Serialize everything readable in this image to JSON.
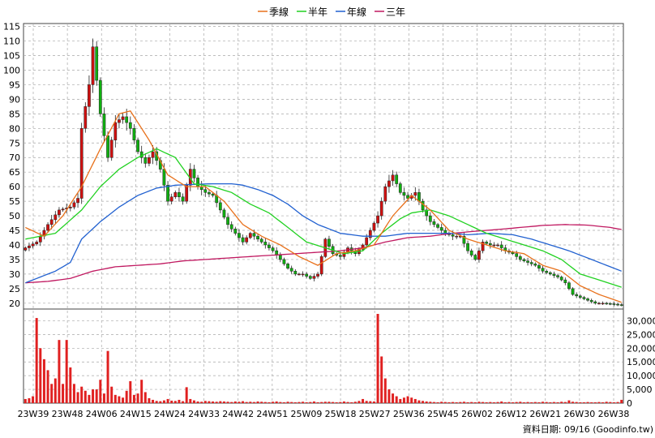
{
  "chart_data": {
    "type": "candlestick",
    "legend": [
      {
        "name": "季線",
        "color": "#e8701a"
      },
      {
        "name": "半年",
        "color": "#21d121"
      },
      {
        "name": "年線",
        "color": "#2060d0"
      },
      {
        "name": "三年",
        "color": "#c01860"
      }
    ],
    "price_axis": {
      "min": 18,
      "max": 116,
      "ticks": [
        20,
        25,
        30,
        35,
        40,
        45,
        50,
        55,
        60,
        65,
        70,
        75,
        80,
        85,
        90,
        95,
        100,
        105,
        110,
        115
      ],
      "side": "left"
    },
    "volume_axis": {
      "min": 0,
      "max": 32500,
      "ticks": [
        0,
        5000,
        10000,
        15000,
        20000,
        25000,
        30000
      ],
      "tick_labels": [
        "0",
        "5,000",
        "10,000",
        "15,000",
        "20,000",
        "25,000",
        "30,000"
      ],
      "side": "right"
    },
    "x_tick_labels": [
      "23W39",
      "23W48",
      "24W06",
      "24W15",
      "24W24",
      "24W33",
      "24W42",
      "24W51",
      "25W09",
      "25W18",
      "25W27",
      "25W36",
      "25W45",
      "26W02",
      "26W12",
      "26W21",
      "26W30",
      "26W38"
    ],
    "grid": true,
    "footer": "資料日期: 09/16  (Goodinfo.tw)",
    "price_close_anchors": [
      [
        0,
        39
      ],
      [
        3,
        41
      ],
      [
        6,
        47
      ],
      [
        9,
        52
      ],
      [
        12,
        53
      ],
      [
        14,
        56
      ],
      [
        15,
        80
      ],
      [
        17,
        95
      ],
      [
        18,
        108
      ],
      [
        20,
        85
      ],
      [
        22,
        70
      ],
      [
        24,
        82
      ],
      [
        26,
        84
      ],
      [
        28,
        80
      ],
      [
        30,
        72
      ],
      [
        32,
        68
      ],
      [
        34,
        72
      ],
      [
        36,
        66
      ],
      [
        38,
        55
      ],
      [
        40,
        58
      ],
      [
        42,
        55
      ],
      [
        44,
        66
      ],
      [
        46,
        60
      ],
      [
        48,
        58
      ],
      [
        50,
        57
      ],
      [
        52,
        52
      ],
      [
        54,
        47
      ],
      [
        56,
        44
      ],
      [
        58,
        41
      ],
      [
        60,
        44
      ],
      [
        62,
        42
      ],
      [
        64,
        40
      ],
      [
        66,
        38
      ],
      [
        68,
        35
      ],
      [
        70,
        32
      ],
      [
        72,
        30
      ],
      [
        74,
        30
      ],
      [
        76,
        28.5
      ],
      [
        78,
        30
      ],
      [
        80,
        42
      ],
      [
        82,
        37
      ],
      [
        84,
        36
      ],
      [
        86,
        39
      ],
      [
        88,
        37
      ],
      [
        90,
        40
      ],
      [
        92,
        45
      ],
      [
        94,
        50
      ],
      [
        96,
        60
      ],
      [
        98,
        64
      ],
      [
        100,
        58
      ],
      [
        102,
        56
      ],
      [
        104,
        58
      ],
      [
        106,
        52
      ],
      [
        108,
        48
      ],
      [
        110,
        46
      ],
      [
        112,
        44
      ],
      [
        114,
        43
      ],
      [
        116,
        43
      ],
      [
        118,
        38
      ],
      [
        120,
        35
      ],
      [
        122,
        41
      ],
      [
        124,
        40
      ],
      [
        126,
        40
      ],
      [
        128,
        38
      ],
      [
        130,
        37
      ],
      [
        132,
        35
      ],
      [
        134,
        34
      ],
      [
        136,
        33
      ],
      [
        138,
        31
      ],
      [
        140,
        30
      ],
      [
        142,
        29
      ],
      [
        144,
        27
      ],
      [
        146,
        23
      ],
      [
        148,
        22
      ],
      [
        150,
        21
      ],
      [
        152,
        20
      ],
      [
        154,
        20
      ],
      [
        156,
        19.8
      ],
      [
        158,
        19.5
      ],
      [
        159,
        19.4
      ]
    ],
    "ma_quarter": [
      [
        0,
        46
      ],
      [
        5,
        43
      ],
      [
        10,
        50
      ],
      [
        15,
        60
      ],
      [
        20,
        73
      ],
      [
        25,
        85
      ],
      [
        28,
        86
      ],
      [
        33,
        76
      ],
      [
        38,
        64
      ],
      [
        43,
        60
      ],
      [
        48,
        60
      ],
      [
        53,
        55
      ],
      [
        58,
        47
      ],
      [
        63,
        43
      ],
      [
        68,
        40
      ],
      [
        73,
        36
      ],
      [
        78,
        33
      ],
      [
        83,
        37
      ],
      [
        88,
        38
      ],
      [
        93,
        40
      ],
      [
        98,
        50
      ],
      [
        103,
        57
      ],
      [
        108,
        52
      ],
      [
        113,
        45
      ],
      [
        118,
        42
      ],
      [
        123,
        40
      ],
      [
        128,
        38
      ],
      [
        133,
        37
      ],
      [
        138,
        33
      ],
      [
        143,
        31
      ],
      [
        148,
        26
      ],
      [
        153,
        23
      ],
      [
        159,
        20.3
      ]
    ],
    "ma_half": [
      [
        0,
        42
      ],
      [
        8,
        44
      ],
      [
        15,
        52
      ],
      [
        20,
        60
      ],
      [
        25,
        66
      ],
      [
        30,
        70
      ],
      [
        35,
        73
      ],
      [
        40,
        70
      ],
      [
        45,
        61
      ],
      [
        50,
        60
      ],
      [
        55,
        58
      ],
      [
        60,
        54
      ],
      [
        65,
        51
      ],
      [
        70,
        46
      ],
      [
        75,
        41
      ],
      [
        80,
        39
      ],
      [
        85,
        37
      ],
      [
        90,
        38
      ],
      [
        95,
        44
      ],
      [
        100,
        49
      ],
      [
        103,
        51
      ],
      [
        108,
        52
      ],
      [
        113,
        50
      ],
      [
        118,
        47
      ],
      [
        123,
        44
      ],
      [
        128,
        42
      ],
      [
        133,
        40
      ],
      [
        138,
        38
      ],
      [
        143,
        35
      ],
      [
        148,
        30
      ],
      [
        153,
        28
      ],
      [
        159,
        25.5
      ]
    ],
    "ma_year": [
      [
        0,
        27
      ],
      [
        4,
        29
      ],
      [
        8,
        31
      ],
      [
        12,
        34
      ],
      [
        15,
        42
      ],
      [
        20,
        48
      ],
      [
        25,
        53
      ],
      [
        30,
        57
      ],
      [
        35,
        59.5
      ],
      [
        40,
        60.5
      ],
      [
        45,
        60.8
      ],
      [
        50,
        61
      ],
      [
        55,
        61
      ],
      [
        58,
        60.5
      ],
      [
        62,
        59
      ],
      [
        66,
        57
      ],
      [
        70,
        54
      ],
      [
        74,
        50
      ],
      [
        78,
        47
      ],
      [
        84,
        44
      ],
      [
        90,
        43
      ],
      [
        96,
        43
      ],
      [
        102,
        44
      ],
      [
        108,
        44
      ],
      [
        114,
        44
      ],
      [
        118,
        43.5
      ],
      [
        124,
        44
      ],
      [
        130,
        43.5
      ],
      [
        135,
        42
      ],
      [
        140,
        40
      ],
      [
        145,
        38
      ],
      [
        150,
        35.5
      ],
      [
        155,
        33
      ],
      [
        159,
        31
      ]
    ],
    "ma_3year": [
      [
        0,
        27
      ],
      [
        6,
        27.5
      ],
      [
        12,
        28.5
      ],
      [
        18,
        31
      ],
      [
        24,
        32.5
      ],
      [
        30,
        33
      ],
      [
        36,
        33.5
      ],
      [
        42,
        34.5
      ],
      [
        48,
        35
      ],
      [
        54,
        35.5
      ],
      [
        60,
        36
      ],
      [
        66,
        36.5
      ],
      [
        72,
        37
      ],
      [
        78,
        37.5
      ],
      [
        84,
        38
      ],
      [
        90,
        39
      ],
      [
        96,
        41
      ],
      [
        102,
        42.5
      ],
      [
        108,
        43
      ],
      [
        114,
        44
      ],
      [
        120,
        44.7
      ],
      [
        126,
        45.3
      ],
      [
        132,
        46
      ],
      [
        138,
        46.7
      ],
      [
        144,
        47
      ],
      [
        150,
        46.8
      ],
      [
        156,
        46
      ],
      [
        159,
        45.3
      ]
    ],
    "volume_bars": [
      [
        0,
        1500
      ],
      [
        1,
        1800
      ],
      [
        2,
        2500
      ],
      [
        3,
        31000
      ],
      [
        4,
        20000
      ],
      [
        5,
        16000
      ],
      [
        6,
        12000
      ],
      [
        7,
        7000
      ],
      [
        8,
        9000
      ],
      [
        9,
        23000
      ],
      [
        10,
        7000
      ],
      [
        11,
        23000
      ],
      [
        12,
        13000
      ],
      [
        13,
        7000
      ],
      [
        14,
        4000
      ],
      [
        15,
        6000
      ],
      [
        16,
        4500
      ],
      [
        17,
        3000
      ],
      [
        18,
        5000
      ],
      [
        19,
        5000
      ],
      [
        20,
        8500
      ],
      [
        21,
        3500
      ],
      [
        22,
        19000
      ],
      [
        23,
        6000
      ],
      [
        24,
        3000
      ],
      [
        25,
        2500
      ],
      [
        26,
        2000
      ],
      [
        27,
        4500
      ],
      [
        28,
        8000
      ],
      [
        29,
        3000
      ],
      [
        30,
        3500
      ],
      [
        31,
        8500
      ],
      [
        32,
        4000
      ],
      [
        33,
        1800
      ],
      [
        34,
        1200
      ],
      [
        35,
        800
      ],
      [
        36,
        700
      ],
      [
        37,
        1000
      ],
      [
        38,
        1500
      ],
      [
        39,
        900
      ],
      [
        40,
        800
      ],
      [
        41,
        1200
      ],
      [
        42,
        700
      ],
      [
        43,
        5800
      ],
      [
        44,
        1500
      ],
      [
        45,
        1000
      ],
      [
        46,
        600
      ],
      [
        47,
        500
      ],
      [
        48,
        800
      ],
      [
        49,
        700
      ],
      [
        50,
        600
      ],
      [
        51,
        500
      ],
      [
        52,
        700
      ],
      [
        53,
        600
      ],
      [
        54,
        500
      ],
      [
        55,
        400
      ],
      [
        56,
        600
      ],
      [
        57,
        500
      ],
      [
        58,
        700
      ],
      [
        59,
        400
      ],
      [
        60,
        500
      ],
      [
        61,
        400
      ],
      [
        62,
        600
      ],
      [
        63,
        500
      ],
      [
        64,
        400
      ],
      [
        65,
        300
      ],
      [
        66,
        500
      ],
      [
        67,
        600
      ],
      [
        68,
        400
      ],
      [
        69,
        300
      ],
      [
        70,
        500
      ],
      [
        71,
        400
      ],
      [
        72,
        300
      ],
      [
        73,
        400
      ],
      [
        74,
        500
      ],
      [
        75,
        300
      ],
      [
        76,
        400
      ],
      [
        77,
        600
      ],
      [
        78,
        300
      ],
      [
        79,
        400
      ],
      [
        80,
        500
      ],
      [
        81,
        500
      ],
      [
        82,
        400
      ],
      [
        83,
        300
      ],
      [
        84,
        400
      ],
      [
        85,
        600
      ],
      [
        86,
        400
      ],
      [
        87,
        300
      ],
      [
        88,
        500
      ],
      [
        89,
        800
      ],
      [
        90,
        1500
      ],
      [
        91,
        800
      ],
      [
        92,
        700
      ],
      [
        93,
        600
      ],
      [
        94,
        32500
      ],
      [
        95,
        17000
      ],
      [
        96,
        9000
      ],
      [
        97,
        5000
      ],
      [
        98,
        3500
      ],
      [
        99,
        2500
      ],
      [
        100,
        1500
      ],
      [
        101,
        2000
      ],
      [
        102,
        2500
      ],
      [
        103,
        2000
      ],
      [
        104,
        1500
      ],
      [
        105,
        1000
      ],
      [
        106,
        800
      ],
      [
        107,
        600
      ],
      [
        108,
        500
      ],
      [
        109,
        400
      ],
      [
        110,
        300
      ],
      [
        111,
        500
      ],
      [
        112,
        400
      ],
      [
        113,
        300
      ],
      [
        114,
        400
      ],
      [
        115,
        300
      ],
      [
        116,
        400
      ],
      [
        117,
        500
      ],
      [
        118,
        300
      ],
      [
        119,
        400
      ],
      [
        120,
        300
      ],
      [
        121,
        500
      ],
      [
        122,
        400
      ],
      [
        123,
        300
      ],
      [
        124,
        400
      ],
      [
        125,
        300
      ],
      [
        126,
        400
      ],
      [
        127,
        600
      ],
      [
        128,
        300
      ],
      [
        129,
        400
      ],
      [
        130,
        300
      ],
      [
        131,
        400
      ],
      [
        132,
        500
      ],
      [
        133,
        300
      ],
      [
        134,
        400
      ],
      [
        135,
        300
      ],
      [
        136,
        400
      ],
      [
        137,
        300
      ],
      [
        138,
        500
      ],
      [
        139,
        400
      ],
      [
        140,
        300
      ],
      [
        141,
        400
      ],
      [
        142,
        300
      ],
      [
        143,
        500
      ],
      [
        144,
        400
      ],
      [
        145,
        1000
      ],
      [
        146,
        500
      ],
      [
        147,
        400
      ],
      [
        148,
        300
      ],
      [
        149,
        300
      ],
      [
        150,
        400
      ],
      [
        151,
        300
      ],
      [
        152,
        300
      ],
      [
        153,
        400
      ],
      [
        154,
        300
      ],
      [
        155,
        500
      ],
      [
        156,
        400
      ],
      [
        157,
        300
      ],
      [
        158,
        400
      ],
      [
        159,
        1200
      ]
    ]
  }
}
